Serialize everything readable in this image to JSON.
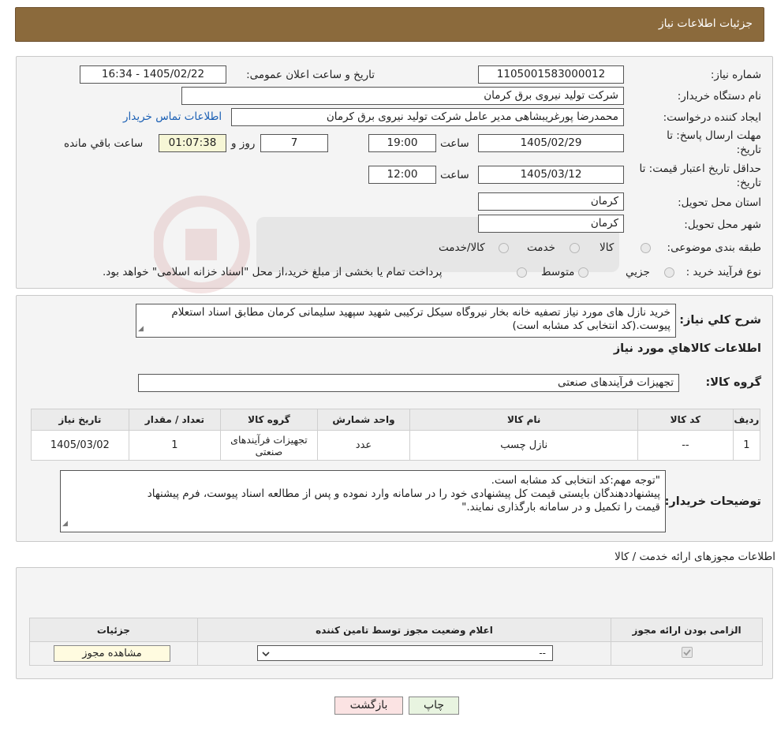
{
  "header": {
    "title": "جزئیات اطلاعات نیاز"
  },
  "form": {
    "need_number_label": "شماره نیاز:",
    "need_number": "1105001583000012",
    "announce_label": "تاریخ و ساعت اعلان عمومی:",
    "announce_value": "1405/02/22 - 16:34",
    "buyer_org_label": "نام دستگاه خریدار:",
    "buyer_org": "شرکت تولید نیروی برق کرمان",
    "requester_label": "ایجاد کننده درخواست:",
    "requester": "محمدرضا پورغریبشاهی مدیر عامل شرکت تولید نیروی برق کرمان",
    "contact_link": "اطلاعات تماس خریدار",
    "reply_deadline_label_1": "مهلت ارسال پاسخ: تا",
    "reply_deadline_label_2": "تاریخ:",
    "reply_date": "1405/02/29",
    "time_label": "ساعت",
    "reply_time": "19:00",
    "days_value": "7",
    "days_label": "روز و",
    "remaining_time": "01:07:38",
    "remaining_label": "ساعت باقي مانده",
    "validity_label_1": "حداقل تاریخ اعتبار قیمت: تا",
    "validity_label_2": "تاریخ:",
    "validity_date": "1405/03/12",
    "validity_time": "12:00",
    "province_label": "استان محل تحویل:",
    "province": "کرمان",
    "city_label": "شهر محل تحویل:",
    "city": "کرمان",
    "category_label": "طبقه بندی موضوعی:",
    "category_options": [
      "کالا",
      "خدمت",
      "کالا/خدمت"
    ],
    "process_label": "نوع فرآیند خرید :",
    "process_options": [
      "جزیي",
      "متوسط"
    ],
    "process_note": "پرداخت تمام یا بخشی از مبلغ خرید،از محل \"اسناد خزانه اسلامی\" خواهد بود."
  },
  "summary": {
    "label": "شرح کلي نياز:",
    "text": "خرید نازل های مورد نیاز تصفیه خانه بخار نیروگاه سیکل ترکیبی شهید سپهید سلیمانی کرمان مطابق اسناد استعلام پیوست.(کد انتخابی کد مشابه است)",
    "goods_info_title": "اطلاعات کالاهاي مورد نياز",
    "group_label": "گروه کالا:",
    "group_value": "تجهیزات فرآیندهای صنعتی"
  },
  "goods_table": {
    "headers": [
      "ردیف",
      "کد کالا",
      "نام کالا",
      "واحد شمارش",
      "گروه کالا",
      "تعداد / مقدار",
      "تاریخ نیاز"
    ],
    "rows": [
      [
        "1",
        "--",
        "نازل چسب",
        "عدد",
        "تجهیزات فرآیندهای صنعتی",
        "1",
        "1405/03/02"
      ]
    ]
  },
  "buyer_notes": {
    "label": "توضیحات خریدار:",
    "line1": "\"توجه مهم:کد انتخابی کد مشابه است.",
    "line2": "پیشنهاددهندگان بایستی قیمت کل پیشنهادی خود را در سامانه وارد نموده و پس از مطالعه اسناد پیوست، فرم پیشنهاد",
    "line3": "قیمت را تکمیل و در سامانه بارگذاری نمایند.\""
  },
  "permits": {
    "title": "اطلاعات مجوزهای ارائه خدمت / کالا",
    "headers": [
      "الزامی بودن ارائه مجوز",
      "اعلام وضعیت مجوز توسط تامین کننده",
      "جزئیات"
    ],
    "select_value": "--",
    "view_button": "مشاهده مجوز"
  },
  "footer": {
    "print_button": "چاپ",
    "back_button": "بازگشت"
  },
  "colors": {
    "header_bg": "#8b6a3c",
    "link": "#1a5fb4",
    "back_button_bg": "#fbe3e3",
    "print_button_bg": "#e8f4e0"
  }
}
